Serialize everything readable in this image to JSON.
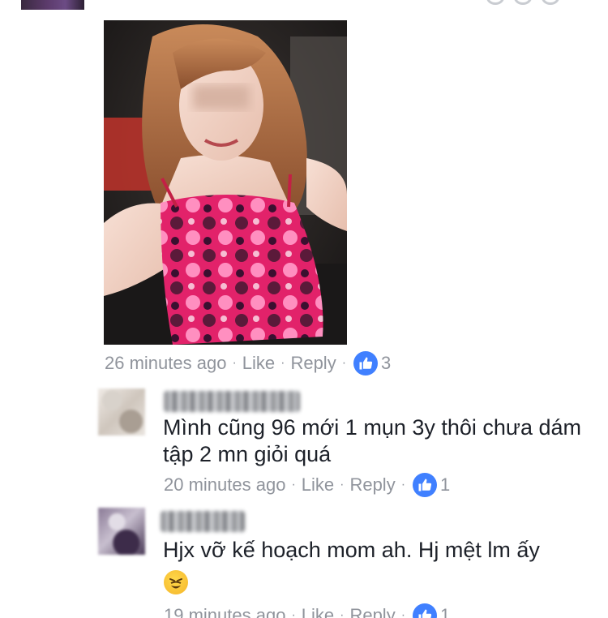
{
  "post": {
    "meta": {
      "time": "26 minutes ago",
      "like": "Like",
      "reply": "Reply",
      "sep": "·",
      "reactions": "3"
    }
  },
  "replies": [
    {
      "text": "Mình cũng 96 mới 1 mụn 3y thôi chưa dám tập 2 mn giỏi quá",
      "time": "20 minutes ago",
      "like": "Like",
      "reply": "Reply",
      "reactions": "1"
    },
    {
      "text": "Hjx vỡ kế hoạch mom ah. Hj mệt lm ấy",
      "emoji": "tired-face-emoji",
      "time": "19 minutes ago",
      "like": "Like",
      "reply": "Reply",
      "reactions": "1"
    }
  ],
  "colors": {
    "meta_text": "#90949c",
    "like_badge": "#4080ff",
    "body_text": "#1d2129"
  },
  "icons": {
    "like_badge": "thumbs-up-icon"
  }
}
